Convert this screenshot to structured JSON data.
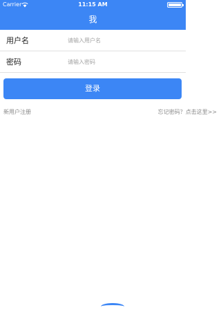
{
  "status_bar": {
    "carrier": "Carrier",
    "time": "11:15 AM"
  },
  "header": {
    "title": "我"
  },
  "form": {
    "username": {
      "label": "用户名",
      "placeholder": "请输入用户名",
      "value": ""
    },
    "password": {
      "label": "密码",
      "placeholder": "请输入密码",
      "value": ""
    }
  },
  "actions": {
    "login_label": "登录",
    "register_label": "新用户注册",
    "forgot_label": "忘记密码？点击这里>>"
  },
  "colors": {
    "accent": "#3c86f5",
    "divider": "#e1e1e1",
    "muted_text": "#8a8a8a"
  }
}
